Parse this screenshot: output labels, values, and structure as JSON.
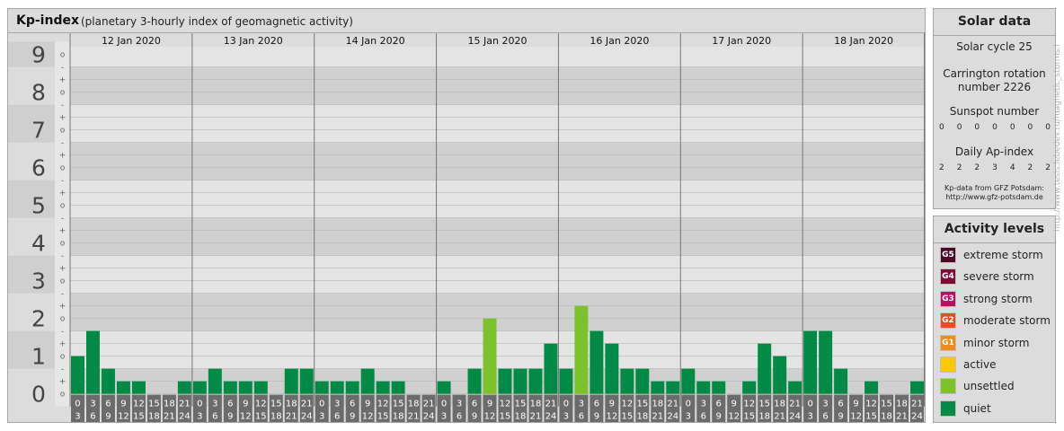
{
  "header": {
    "title": "Kp-index",
    "subtitle": "(planetary 3-hourly index of geomagnetic activity)"
  },
  "chart_data": {
    "type": "bar",
    "days": [
      "12 Jan 2020",
      "13 Jan 2020",
      "14 Jan 2020",
      "15 Jan 2020",
      "16 Jan 2020",
      "17 Jan 2020",
      "18 Jan 2020"
    ],
    "interval_labels": [
      [
        "0",
        "3"
      ],
      [
        "3",
        "6"
      ],
      [
        "6",
        "9"
      ],
      [
        "9",
        "12"
      ],
      [
        "12",
        "15"
      ],
      [
        "15",
        "18"
      ],
      [
        "18",
        "21"
      ],
      [
        "21",
        "24"
      ]
    ],
    "y_ticks": [
      "0",
      "1",
      "2",
      "3",
      "4",
      "5",
      "6",
      "7",
      "8",
      "9"
    ],
    "y_minor_labels": [
      "-",
      "o",
      "+"
    ],
    "ylim": [
      0,
      9
    ],
    "values": [
      [
        1.0,
        1.667,
        0.667,
        0.333,
        0.333,
        0.0,
        0.0,
        0.333
      ],
      [
        0.333,
        0.667,
        0.333,
        0.333,
        0.333,
        0.0,
        0.667,
        0.667
      ],
      [
        0.333,
        0.333,
        0.333,
        0.667,
        0.333,
        0.333,
        0.0,
        0.0
      ],
      [
        0.333,
        0.0,
        0.667,
        2.0,
        0.667,
        0.667,
        0.667,
        1.333
      ],
      [
        0.667,
        2.333,
        1.667,
        1.333,
        0.667,
        0.667,
        0.333,
        0.333
      ],
      [
        0.667,
        0.333,
        0.333,
        0.0,
        0.333,
        1.333,
        1.0,
        0.333
      ],
      [
        1.667,
        1.667,
        0.667,
        0.0,
        0.333,
        0.0,
        0.0,
        0.333
      ]
    ],
    "grid": true
  },
  "solar": {
    "title": "Solar data",
    "solar_cycle": "Solar cycle 25",
    "carrington_line1": "Carrington rotation",
    "carrington_line2": "number 2226",
    "sunspot_label": "Sunspot number",
    "sunspot_values": [
      "0",
      "0",
      "0",
      "0",
      "0",
      "0",
      "0"
    ],
    "ap_label": "Daily Ap-index",
    "ap_values": [
      "2",
      "2",
      "2",
      "3",
      "4",
      "2",
      "2"
    ],
    "credit_line1": "Kp-data from GFZ Potsdam:",
    "credit_line2": "http://www.gfz-potsdam.de"
  },
  "activity": {
    "title": "Activity levels",
    "levels": [
      {
        "badge": "G5",
        "label": "extreme storm",
        "color": "#4a0a23"
      },
      {
        "badge": "G4",
        "label": "severe storm",
        "color": "#7a0d3a"
      },
      {
        "badge": "G3",
        "label": "strong storm",
        "color": "#b80f62"
      },
      {
        "badge": "G2",
        "label": "moderate storm",
        "color": "#e05020"
      },
      {
        "badge": "G1",
        "label": "minor storm",
        "color": "#ef8a1c"
      },
      {
        "badge": "",
        "label": "active",
        "color": "#ffc60a"
      },
      {
        "badge": "",
        "label": "unsettled",
        "color": "#7dc12c"
      },
      {
        "badge": "",
        "label": "quiet",
        "color": "#008a45"
      }
    ]
  },
  "watermark": "http://www.tesis.lebedev.ru/magnetic_storms.html"
}
